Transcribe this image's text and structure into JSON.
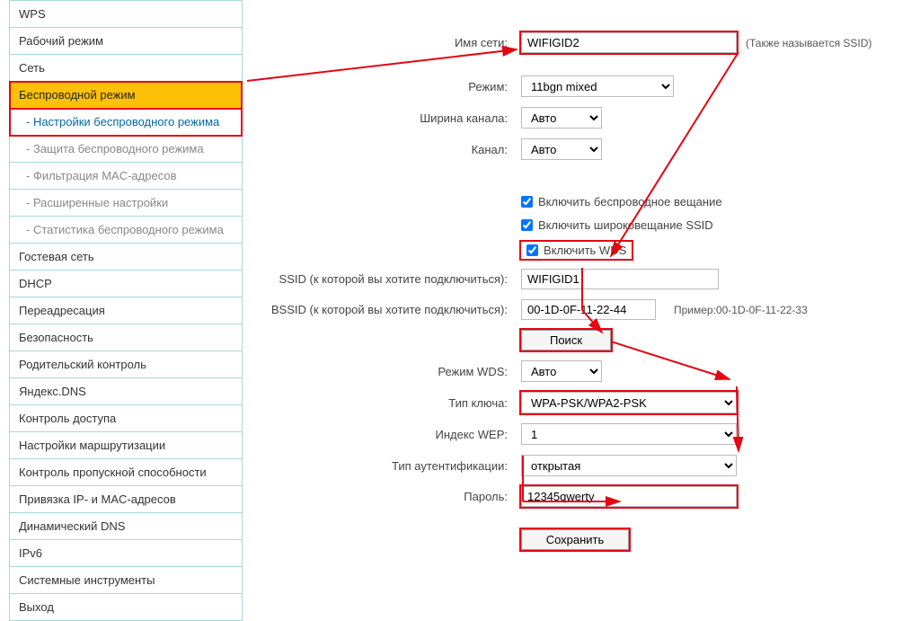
{
  "sidebar": {
    "items": [
      {
        "label": "WPS",
        "cls": ""
      },
      {
        "label": "Рабочий режим",
        "cls": ""
      },
      {
        "label": "Сеть",
        "cls": ""
      },
      {
        "label": "Беспроводной режим",
        "cls": "active-main hl-box"
      },
      {
        "label": "- Настройки беспроводного режима",
        "cls": "active-sub hl-box"
      },
      {
        "label": "- Защита беспроводного режима",
        "cls": "sub"
      },
      {
        "label": "- Фильтрация MAC-адресов",
        "cls": "sub"
      },
      {
        "label": "- Расширенные настройки",
        "cls": "sub"
      },
      {
        "label": "- Статистика беспроводного режима",
        "cls": "sub"
      },
      {
        "label": "Гостевая сеть",
        "cls": ""
      },
      {
        "label": "DHCP",
        "cls": ""
      },
      {
        "label": "Переадресация",
        "cls": ""
      },
      {
        "label": "Безопасность",
        "cls": ""
      },
      {
        "label": "Родительский контроль",
        "cls": ""
      },
      {
        "label": "Яндекс.DNS",
        "cls": ""
      },
      {
        "label": "Контроль доступа",
        "cls": ""
      },
      {
        "label": "Настройки маршрутизации",
        "cls": ""
      },
      {
        "label": "Контроль пропускной способности",
        "cls": ""
      },
      {
        "label": "Привязка IP- и MAC-адресов",
        "cls": ""
      },
      {
        "label": "Динамический DNS",
        "cls": ""
      },
      {
        "label": "IPv6",
        "cls": ""
      },
      {
        "label": "Системные инструменты",
        "cls": ""
      },
      {
        "label": "Выход",
        "cls": ""
      }
    ]
  },
  "labels": {
    "ssid_name": "Имя сети:",
    "mode": "Режим:",
    "chan_width": "Ширина канала:",
    "channel": "Канал:",
    "enable_wireless": "Включить беспроводное вещание",
    "enable_ssid_bcast": "Включить широковещание SSID",
    "enable_wds": "Включить WDS",
    "target_ssid": "SSID (к которой вы хотите подключиться):",
    "target_bssid": "BSSID (к которой вы хотите подключиться):",
    "wds_mode": "Режим WDS:",
    "key_type": "Тип ключа:",
    "wep_index": "Индекс WEP:",
    "auth_type": "Тип аутентификации:",
    "password": "Пароль:",
    "also_called": "(Также называется SSID)",
    "bssid_example": "Пример:00-1D-0F-11-22-33",
    "search_btn": "Поиск",
    "save_btn": "Сохранить"
  },
  "fields": {
    "ssid_name": "WIFIGID2",
    "mode": "11bgn mixed",
    "chan_width": "Авто",
    "channel": "Авто",
    "target_ssid": "WIFIGID1",
    "target_bssid": "00-1D-0F-11-22-44",
    "wds_mode": "Авто",
    "key_type": "WPA-PSK/WPA2-PSK",
    "wep_index": "1",
    "auth_type": "открытая",
    "password": "12345qwerty"
  },
  "checks": {
    "wireless": true,
    "ssid_bcast": true,
    "wds": true
  }
}
